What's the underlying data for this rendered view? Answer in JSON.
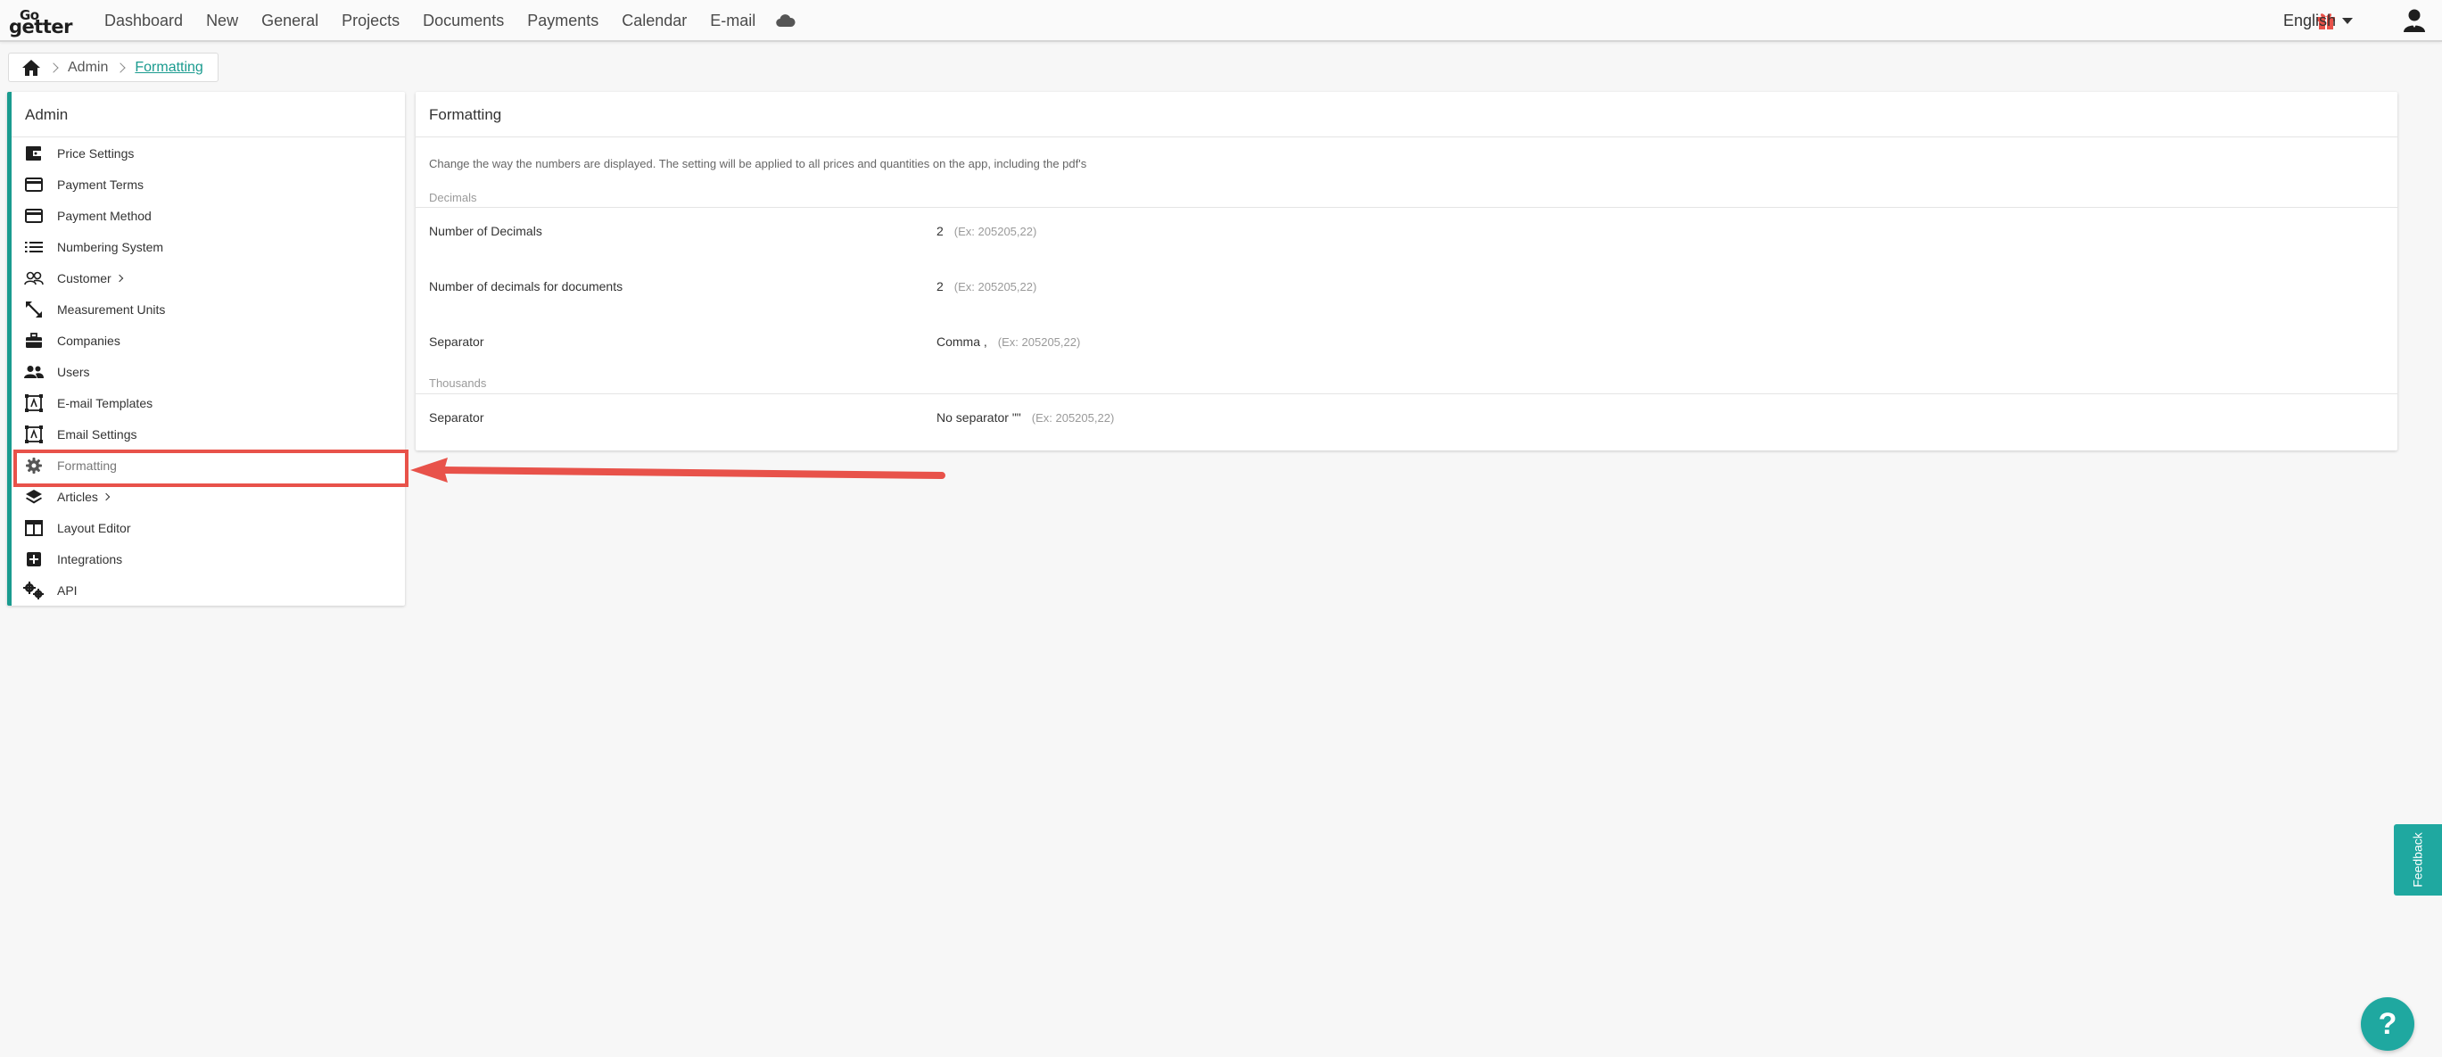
{
  "brand": {
    "logo_top": "Go",
    "logo_bottom": "getter",
    "accent_color": "#1a9b8f",
    "highlight_color": "#e8524a"
  },
  "nav": {
    "items": [
      {
        "label": "Dashboard"
      },
      {
        "label": "New"
      },
      {
        "label": "General"
      },
      {
        "label": "Projects"
      },
      {
        "label": "Documents"
      },
      {
        "label": "Payments"
      },
      {
        "label": "Calendar"
      },
      {
        "label": "E-mail"
      }
    ],
    "cloud_icon": "cloud-icon",
    "gift_icon": "gift-icon",
    "language": "English",
    "user_icon": "user-icon"
  },
  "breadcrumb": {
    "home_icon": "home-icon",
    "parent": "Admin",
    "current": "Formatting"
  },
  "sidebar": {
    "title": "Admin",
    "items": [
      {
        "label": "Price Settings",
        "icon": "wallet-icon"
      },
      {
        "label": "Payment Terms",
        "icon": "credit-card-icon"
      },
      {
        "label": "Payment Method",
        "icon": "credit-card-icon"
      },
      {
        "label": "Numbering System",
        "icon": "list-icon"
      },
      {
        "label": "Customer",
        "icon": "users-outline-icon",
        "has_submenu": true
      },
      {
        "label": "Measurement Units",
        "icon": "resize-arrows-icon"
      },
      {
        "label": "Companies",
        "icon": "briefcase-icon"
      },
      {
        "label": "Users",
        "icon": "users-icon"
      },
      {
        "label": "E-mail Templates",
        "icon": "template-icon"
      },
      {
        "label": "Email Settings",
        "icon": "template-icon"
      },
      {
        "label": "Formatting",
        "icon": "gear-icon",
        "active": true
      },
      {
        "label": "Articles",
        "icon": "layers-icon",
        "has_submenu": true
      },
      {
        "label": "Layout Editor",
        "icon": "layout-icon"
      },
      {
        "label": "Integrations",
        "icon": "plus-square-icon"
      },
      {
        "label": "API",
        "icon": "gears-icon"
      }
    ]
  },
  "panel": {
    "title": "Formatting",
    "description": "Change the way the numbers are displayed. The setting will be applied to all prices and quantities on the app, including the pdf's",
    "decimals_label": "Decimals",
    "thousands_label": "Thousands",
    "rows": {
      "num_decimals": {
        "label": "Number of Decimals",
        "value": "2",
        "example": "(Ex: 205205,22)"
      },
      "num_decimals_docs": {
        "label": "Number of decimals for documents",
        "value": "2",
        "example": "(Ex: 205205,22)"
      },
      "decimal_separator": {
        "label": "Separator",
        "value": "Comma ,",
        "example": "(Ex: 205205,22)"
      },
      "thousands_separator": {
        "label": "Separator",
        "value": "No separator \"\"",
        "example": "(Ex: 205205,22)"
      }
    }
  },
  "feedback": {
    "label": "Feedback"
  },
  "help": {
    "label": "?"
  }
}
